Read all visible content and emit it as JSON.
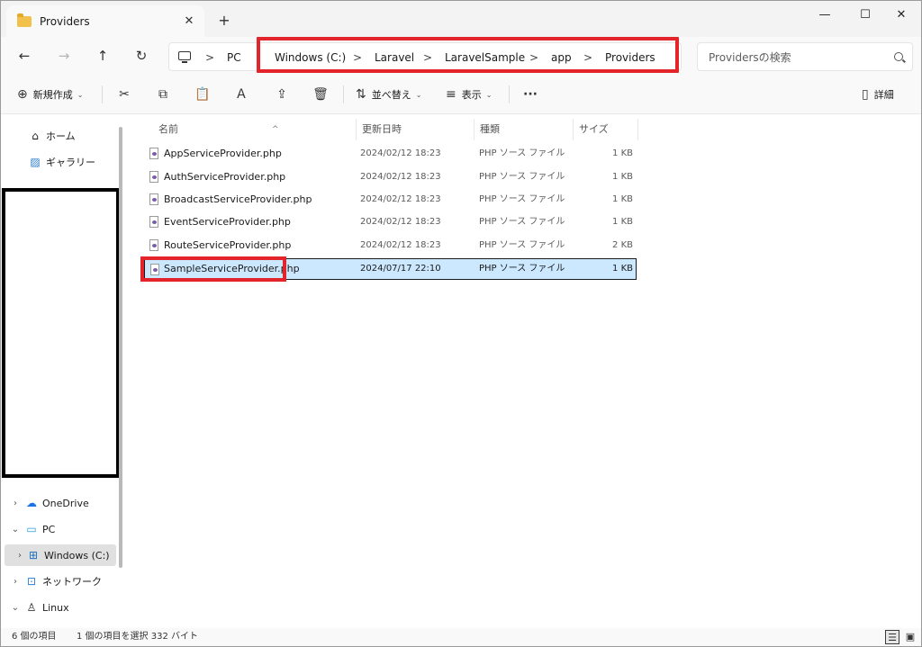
{
  "titlebar": {
    "tab_title": "Providers",
    "tab_close": "✕",
    "add_tab": "+",
    "minimize": "—",
    "maximize": "☐",
    "close": "✕"
  },
  "nav": {
    "back": "←",
    "forward": "→",
    "up": "↑",
    "refresh": "↻",
    "separator": ">",
    "breadcrumbs": [
      "PC",
      "Windows (C:)",
      "Laravel",
      "LaravelSample",
      "app",
      "Providers"
    ],
    "search_placeholder": "Providersの検索"
  },
  "toolbar": {
    "new_label": "新規作成",
    "new_glyph": "⊕",
    "sort_label": "並べ替え",
    "sort_glyph": "⇅",
    "view_label": "表示",
    "view_glyph": "≡",
    "chevron": "⌄",
    "cut": "✂",
    "copy": "⧉",
    "paste": "📋",
    "rename": "Ａ",
    "share": "⇪",
    "delete": "🗑",
    "more": "···",
    "details_label": "詳細",
    "details_glyph": "▯"
  },
  "sidebar": {
    "home": "ホーム",
    "gallery": "ギャラリー",
    "onedrive": "OneDrive",
    "pc": "PC",
    "windows_c": "Windows (C:)",
    "network": "ネットワーク",
    "linux": "Linux",
    "expand_closed": "›",
    "expand_open": "⌄"
  },
  "columns": {
    "name": "名前",
    "modified": "更新日時",
    "type": "種類",
    "size": "サイズ",
    "sort_arrow": "^"
  },
  "files": [
    {
      "name": "AppServiceProvider.php",
      "modified": "2024/02/12 18:23",
      "type": "PHP ソース ファイル",
      "size": "1 KB"
    },
    {
      "name": "AuthServiceProvider.php",
      "modified": "2024/02/12 18:23",
      "type": "PHP ソース ファイル",
      "size": "1 KB"
    },
    {
      "name": "BroadcastServiceProvider.php",
      "modified": "2024/02/12 18:23",
      "type": "PHP ソース ファイル",
      "size": "1 KB"
    },
    {
      "name": "EventServiceProvider.php",
      "modified": "2024/02/12 18:23",
      "type": "PHP ソース ファイル",
      "size": "1 KB"
    },
    {
      "name": "RouteServiceProvider.php",
      "modified": "2024/02/12 18:23",
      "type": "PHP ソース ファイル",
      "size": "2 KB"
    },
    {
      "name": "SampleServiceProvider.php",
      "modified": "2024/07/17 22:10",
      "type": "PHP ソース ファイル",
      "size": "1 KB"
    }
  ],
  "status": {
    "item_count": "6 個の項目",
    "selection": "1 個の項目を選択  332 バイト",
    "details_view": "☰",
    "tiles_view": "▣"
  },
  "colors": {
    "highlight": "#e3242b",
    "selection": "#cce8ff",
    "folder": "#f2c14b"
  }
}
